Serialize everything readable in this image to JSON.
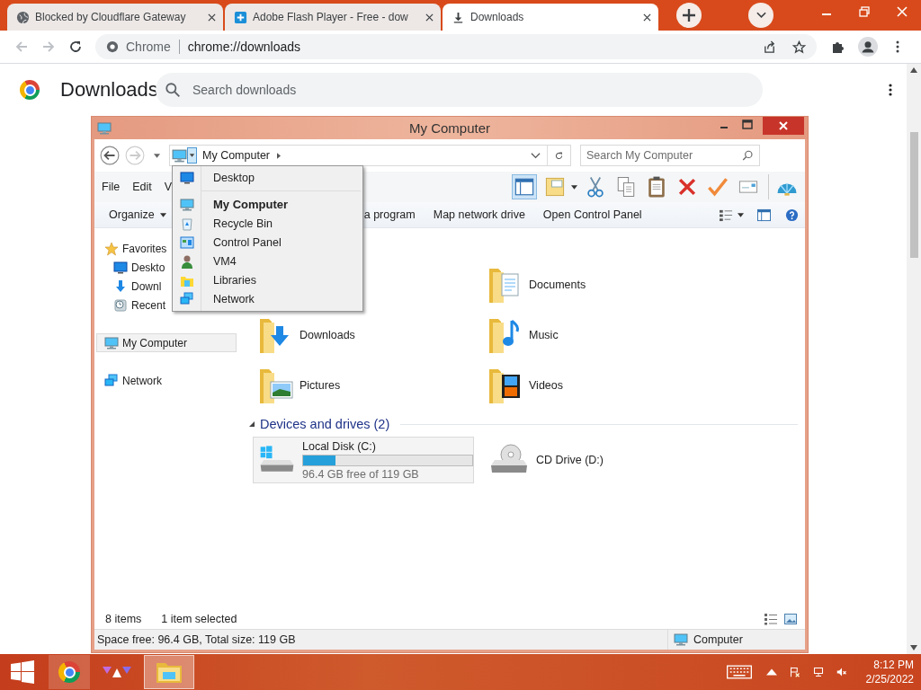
{
  "browser": {
    "tabs": [
      {
        "title": "Blocked by Cloudflare Gateway",
        "kind": "globe",
        "selected": false
      },
      {
        "title": "Adobe Flash Player - Free - dow",
        "kind": "plus",
        "selected": false
      },
      {
        "title": "Downloads",
        "kind": "download",
        "selected": true
      }
    ],
    "site_label": "Chrome",
    "url": "chrome://downloads"
  },
  "page": {
    "title": "Downloads",
    "search": {
      "placeholder": "Search downloads"
    }
  },
  "explorer": {
    "title": "My Computer",
    "breadcrumb": "My Computer",
    "search": {
      "placeholder": "Search My Computer"
    },
    "menu": [
      "File",
      "Edit",
      "V"
    ],
    "commands": [
      "Organize",
      "a program",
      "Map network drive",
      "Open Control Panel"
    ],
    "nav": [
      {
        "label": "Favorites",
        "kind": "star",
        "selected": false,
        "children": [
          {
            "label": "Deskto",
            "kind": "desktop",
            "selected": false
          },
          {
            "label": "Downl",
            "kind": "download",
            "selected": false
          },
          {
            "label": "Recent",
            "kind": "recent",
            "selected": false
          }
        ]
      },
      {
        "label": "My Computer",
        "kind": "computer",
        "selected": true
      },
      {
        "label": "Network",
        "kind": "network",
        "selected": false
      }
    ],
    "folders": [
      {
        "name": "Documents",
        "kind": "documents"
      },
      {
        "name": "Downloads",
        "kind": "downloads"
      },
      {
        "name": "Music",
        "kind": "music"
      },
      {
        "name": "Pictures",
        "kind": "pictures"
      },
      {
        "name": "Videos",
        "kind": "videos"
      }
    ],
    "group_header": "Devices and drives (2)",
    "drives": [
      {
        "name": "Local Disk (C:)",
        "kind": "hdd",
        "selected": true,
        "level": 0.19,
        "free": "96.4 GB free of 119 GB"
      },
      {
        "name": "CD Drive (D:)",
        "kind": "cd",
        "selected": false
      }
    ],
    "dropdown": [
      {
        "label": "Desktop",
        "kind": "desktop",
        "selected": false,
        "separator_after": true
      },
      {
        "label": "My Computer",
        "kind": "computer",
        "selected": true
      },
      {
        "label": "Recycle Bin",
        "kind": "recycle",
        "selected": false
      },
      {
        "label": "Control Panel",
        "kind": "control",
        "selected": false
      },
      {
        "label": "VM4",
        "kind": "user",
        "selected": false
      },
      {
        "label": "Libraries",
        "kind": "libraries",
        "selected": false
      },
      {
        "label": "Network",
        "kind": "network",
        "selected": false
      }
    ],
    "status": {
      "count": "8 items",
      "selection": "1 item selected"
    },
    "details": {
      "space": "Space free: 96.4 GB, Total size: 119 GB",
      "location": "Computer"
    }
  },
  "taskbar": {
    "time": "8:12 PM",
    "date": "2/25/2022"
  }
}
